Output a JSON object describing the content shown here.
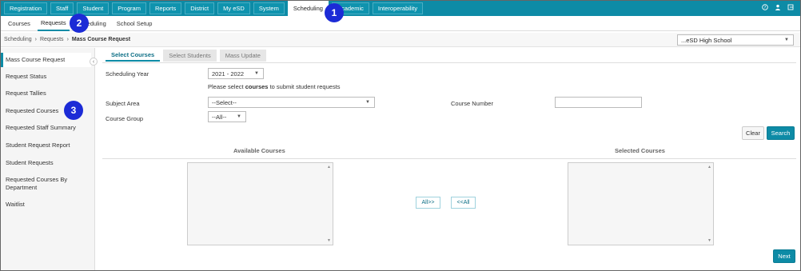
{
  "top_nav": {
    "tabs": [
      "Registration",
      "Staff",
      "Student",
      "Program",
      "Reports",
      "District",
      "My eSD",
      "System",
      "Scheduling",
      "Academic",
      "Interoperability"
    ],
    "active": "Scheduling"
  },
  "sub_nav": {
    "items": [
      "Courses",
      "Requests",
      "Scheduling",
      "School Setup"
    ],
    "active": "Requests"
  },
  "breadcrumb": [
    "Scheduling",
    "Requests",
    "Mass Course Request"
  ],
  "school_select": "...eSD High School",
  "sidebar": {
    "items": [
      "Mass Course Request",
      "Request Status",
      "Request Tallies",
      "Requested Courses",
      "Requested Staff Summary",
      "Student Request Report",
      "Student Requests",
      "Requested Courses By Department",
      "Waitlist"
    ],
    "active": "Mass Course Request"
  },
  "main": {
    "tabs": [
      "Select Courses",
      "Select Students",
      "Mass Update"
    ],
    "active_tab": "Select Courses",
    "scheduling_year_label": "Scheduling Year",
    "scheduling_year_value": "2021 - 2022",
    "note_prefix": "Please select ",
    "note_bold": "courses",
    "note_suffix": " to submit student requests",
    "subject_area_label": "Subject Area",
    "subject_area_value": "--Select--",
    "course_number_label": "Course Number",
    "course_group_label": "Course Group",
    "course_group_value": "--All--",
    "clear_label": "Clear",
    "search_label": "Search",
    "available_courses_label": "Available Courses",
    "selected_courses_label": "Selected Courses",
    "all_right_label": "All>>",
    "all_left_label": "<<All",
    "next_label": "Next"
  },
  "callouts": [
    "1",
    "2",
    "3"
  ],
  "colors": {
    "accent": "#0d8ba6",
    "callout": "#1c2bd6"
  }
}
